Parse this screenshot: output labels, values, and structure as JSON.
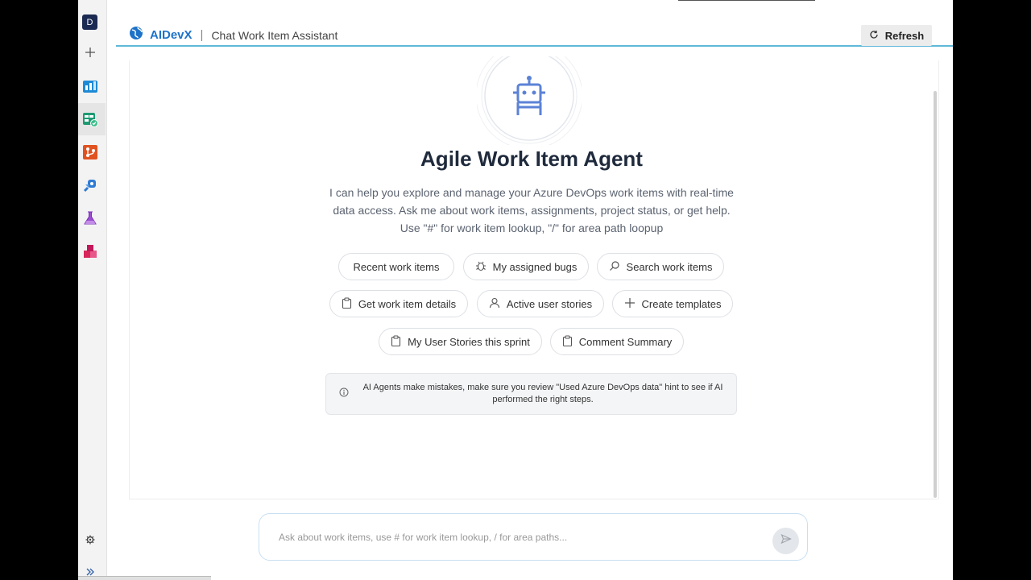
{
  "rail": {
    "avatar_letter": "D",
    "icons": [
      "plus-icon",
      "boards-icon",
      "work-items-icon",
      "repos-icon",
      "pipelines-icon",
      "test-plans-icon",
      "artifacts-icon"
    ],
    "settings_icon": "gear-icon",
    "expand_icon": "double-chevron-icon"
  },
  "header": {
    "brand": "AIDevX",
    "separator": "|",
    "subtitle": "Chat Work Item Assistant",
    "refresh_label": "Refresh"
  },
  "main": {
    "title": "Agile Work Item Agent",
    "description_lines": [
      "I can help you explore and manage your Azure DevOps work items with real-time",
      "data access. Ask me about work items, assignments, project status, or get help.",
      "Use \"#\" for work item lookup, \"/\" for area path loopup"
    ],
    "suggestions": [
      {
        "label": "Recent work items",
        "icon": ""
      },
      {
        "label": "My assigned bugs",
        "icon": "bug-icon"
      },
      {
        "label": "Search work items",
        "icon": "search-icon"
      },
      {
        "label": "Get work item details",
        "icon": "clipboard-icon"
      },
      {
        "label": "Active user stories",
        "icon": "user-icon"
      },
      {
        "label": "Create templates",
        "icon": "plus-icon"
      },
      {
        "label": "My User Stories this sprint",
        "icon": "clipboard-icon"
      },
      {
        "label": "Comment Summary",
        "icon": "clipboard-icon"
      }
    ],
    "notice": "AI Agents make mistakes, make sure you review \"Used Azure DevOps data\" hint to see if AI performed the right steps."
  },
  "input": {
    "placeholder": "Ask about work items, use # for work item lookup, / for area paths..."
  },
  "colors": {
    "brand": "#1e73c8",
    "accent_line": "#5fb8d8",
    "robot": "#5b82d6"
  }
}
